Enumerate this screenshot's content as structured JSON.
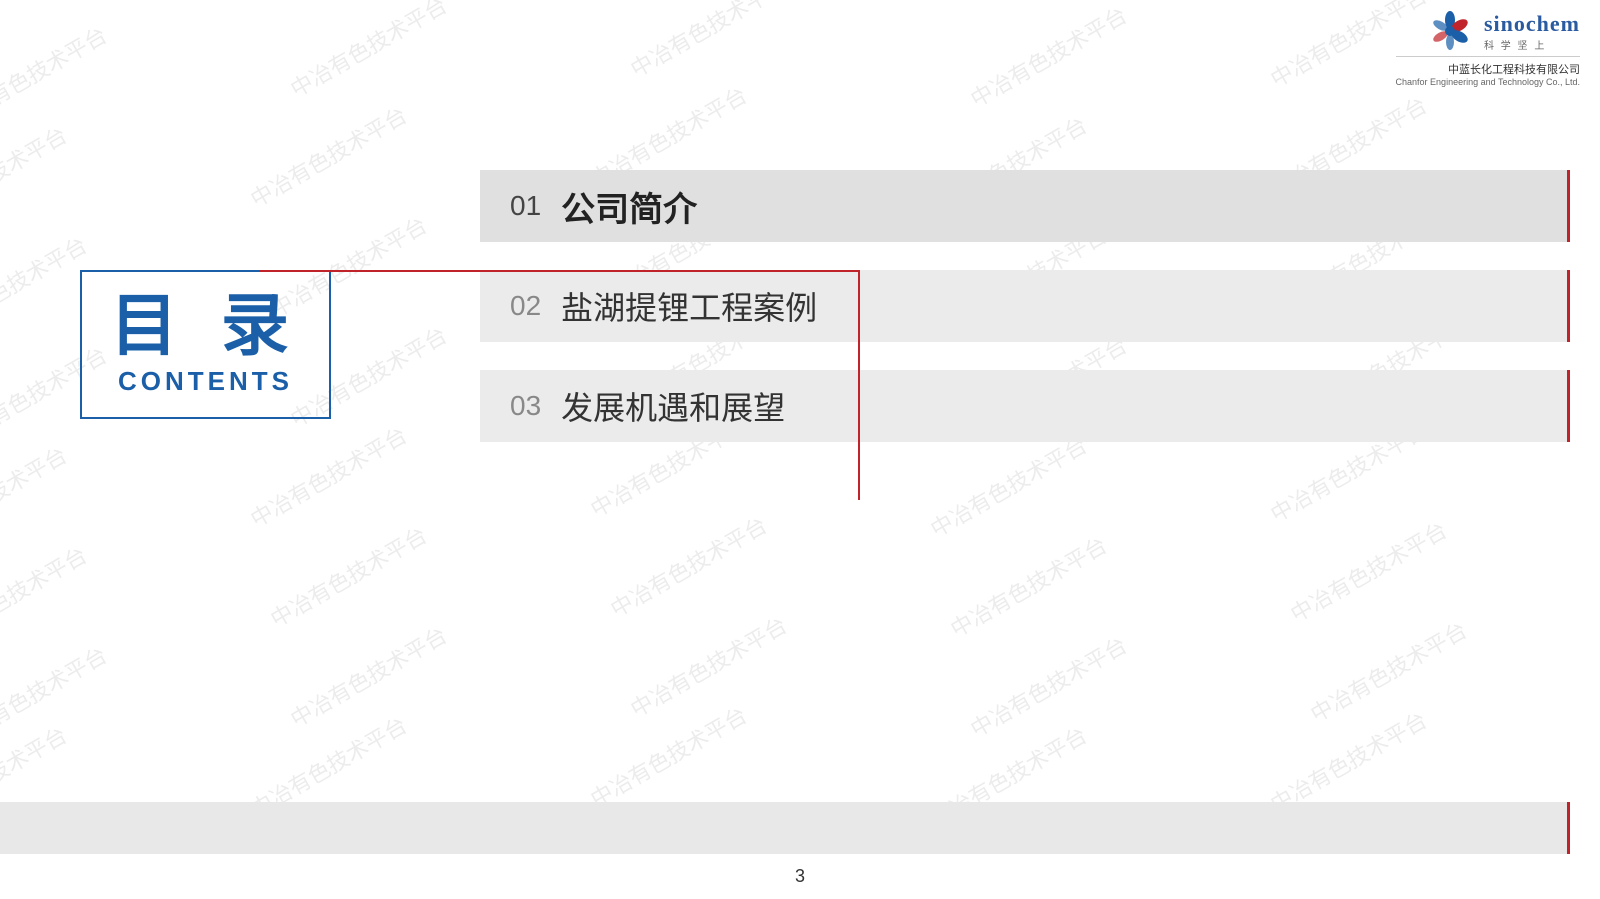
{
  "logo": {
    "brand": "sinochem",
    "tagline": "科 学 坚 上",
    "company_cn": "中蓝长化工程科技有限公司",
    "company_en": "Chanfor Engineering and Technology Co., Ltd."
  },
  "title": {
    "chinese": "目 录",
    "english": "CONTENTS"
  },
  "items": [
    {
      "number": "01",
      "text": "公司简介",
      "active": true
    },
    {
      "number": "02",
      "text": "盐湖提锂工程案例",
      "active": false
    },
    {
      "number": "03",
      "text": "发展机遇和展望",
      "active": false
    }
  ],
  "page_number": "3",
  "watermark": "中冶有色技术平台"
}
